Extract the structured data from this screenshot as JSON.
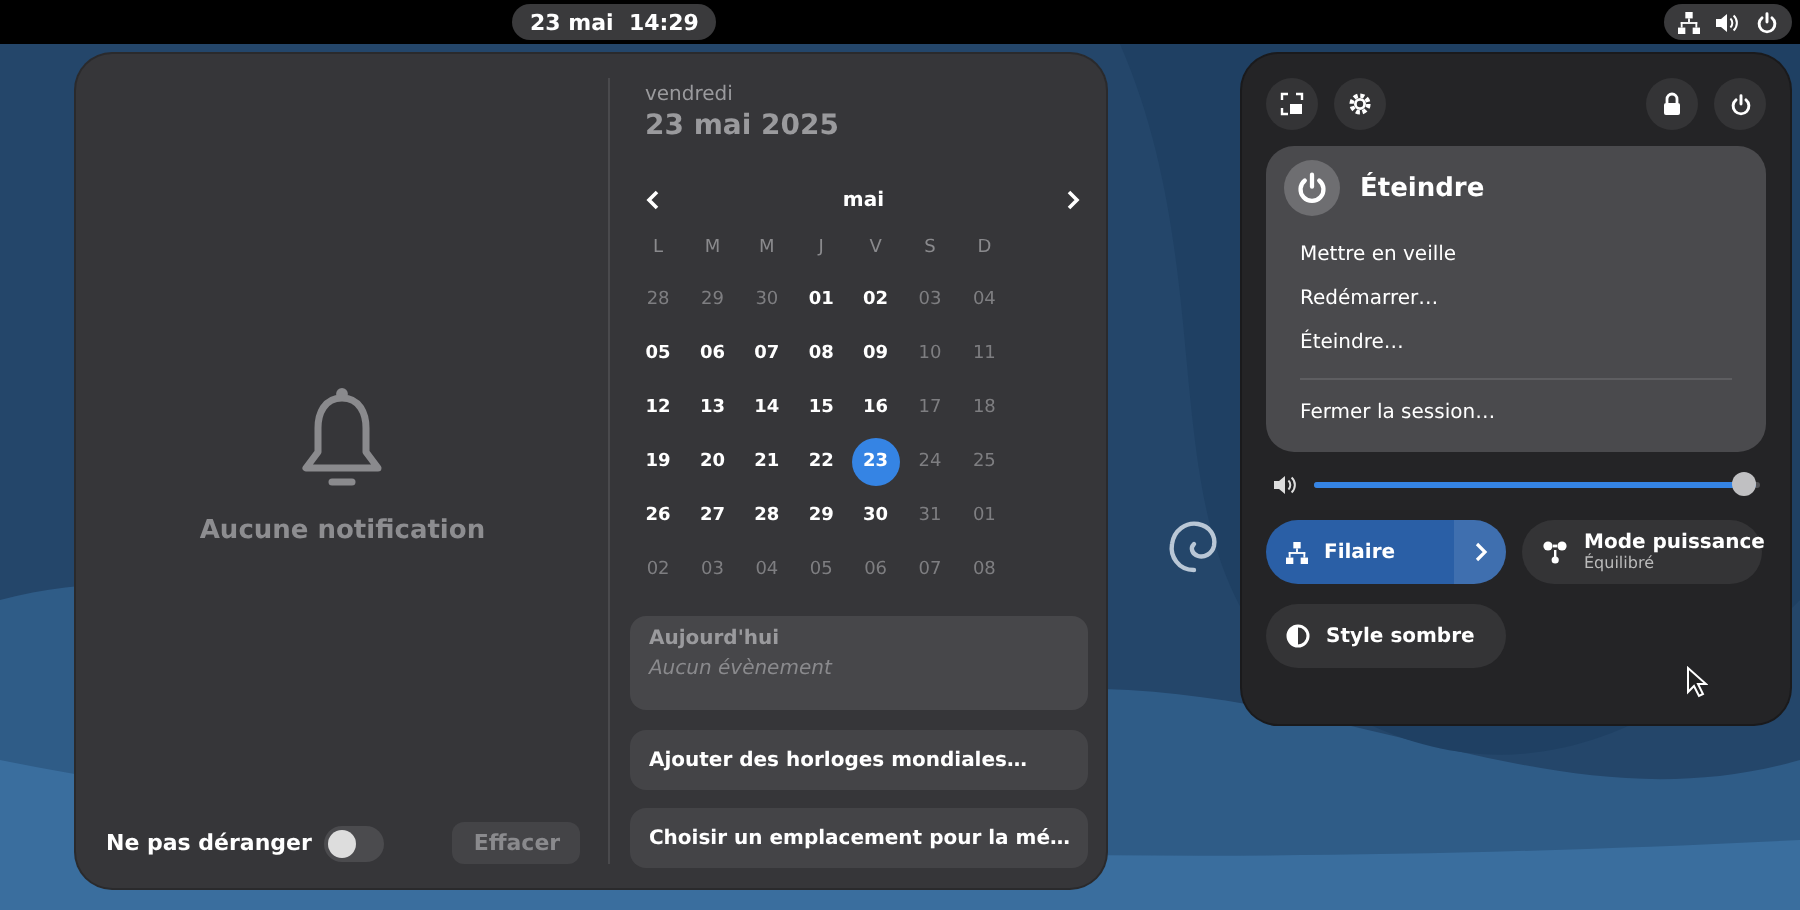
{
  "top_bar": {
    "clock": "23 mai  14:29"
  },
  "notifications": {
    "empty_text": "Aucune notification",
    "dnd": {
      "label": "Ne pas déranger",
      "on": false
    },
    "clear_button": {
      "label": "Effacer",
      "disabled": true
    }
  },
  "calendar": {
    "weekday": "vendredi",
    "date": "23 mai 2025",
    "month": "mai",
    "weekdays": [
      "L",
      "M",
      "M",
      "J",
      "V",
      "S",
      "D"
    ],
    "weeks": [
      [
        {
          "day": "28",
          "muted": true,
          "selected": false
        },
        {
          "day": "29",
          "muted": true,
          "selected": false
        },
        {
          "day": "30",
          "muted": true,
          "selected": false
        },
        {
          "day": "01",
          "muted": false,
          "selected": false
        },
        {
          "day": "02",
          "muted": false,
          "selected": false
        },
        {
          "day": "03",
          "muted": true,
          "selected": false
        },
        {
          "day": "04",
          "muted": true,
          "selected": false
        }
      ],
      [
        {
          "day": "05",
          "muted": false,
          "selected": false
        },
        {
          "day": "06",
          "muted": false,
          "selected": false
        },
        {
          "day": "07",
          "muted": false,
          "selected": false
        },
        {
          "day": "08",
          "muted": false,
          "selected": false
        },
        {
          "day": "09",
          "muted": false,
          "selected": false
        },
        {
          "day": "10",
          "muted": true,
          "selected": false
        },
        {
          "day": "11",
          "muted": true,
          "selected": false
        }
      ],
      [
        {
          "day": "12",
          "muted": false,
          "selected": false
        },
        {
          "day": "13",
          "muted": false,
          "selected": false
        },
        {
          "day": "14",
          "muted": false,
          "selected": false
        },
        {
          "day": "15",
          "muted": false,
          "selected": false
        },
        {
          "day": "16",
          "muted": false,
          "selected": false
        },
        {
          "day": "17",
          "muted": true,
          "selected": false
        },
        {
          "day": "18",
          "muted": true,
          "selected": false
        }
      ],
      [
        {
          "day": "19",
          "muted": false,
          "selected": false
        },
        {
          "day": "20",
          "muted": false,
          "selected": false
        },
        {
          "day": "21",
          "muted": false,
          "selected": false
        },
        {
          "day": "22",
          "muted": false,
          "selected": false
        },
        {
          "day": "23",
          "muted": false,
          "selected": true
        },
        {
          "day": "24",
          "muted": true,
          "selected": false
        },
        {
          "day": "25",
          "muted": true,
          "selected": false
        }
      ],
      [
        {
          "day": "26",
          "muted": false,
          "selected": false
        },
        {
          "day": "27",
          "muted": false,
          "selected": false
        },
        {
          "day": "28",
          "muted": false,
          "selected": false
        },
        {
          "day": "29",
          "muted": false,
          "selected": false
        },
        {
          "day": "30",
          "muted": false,
          "selected": false
        },
        {
          "day": "31",
          "muted": true,
          "selected": false
        },
        {
          "day": "01",
          "muted": true,
          "selected": false
        }
      ],
      [
        {
          "day": "02",
          "muted": true,
          "selected": false
        },
        {
          "day": "03",
          "muted": true,
          "selected": false
        },
        {
          "day": "04",
          "muted": true,
          "selected": false
        },
        {
          "day": "05",
          "muted": true,
          "selected": false
        },
        {
          "day": "06",
          "muted": true,
          "selected": false
        },
        {
          "day": "07",
          "muted": true,
          "selected": false
        },
        {
          "day": "08",
          "muted": true,
          "selected": false
        }
      ]
    ]
  },
  "events": {
    "title": "Aujourd'hui",
    "empty_text": "Aucun évènement"
  },
  "calendar_buttons": [
    "Ajouter des horloges mondiales…",
    "Choisir un emplacement pour la mé…"
  ],
  "quick_settings": {
    "power_menu": {
      "title": "Éteindre",
      "items": [
        {
          "label": "Mettre en veille",
          "separator_before": false
        },
        {
          "label": "Redémarrer…",
          "separator_before": false
        },
        {
          "label": "Éteindre…",
          "separator_before": false
        },
        {
          "label": "Fermer la session…",
          "separator_before": true
        }
      ]
    },
    "volume": {
      "level": 0.99
    },
    "toggles": [
      {
        "kind": "network",
        "label": "Filaire",
        "on": true
      },
      {
        "kind": "power",
        "label": "Mode puissance",
        "subtitle": "Équilibré",
        "on": false
      },
      {
        "kind": "style",
        "label": "Style sombre",
        "on": false
      }
    ]
  }
}
